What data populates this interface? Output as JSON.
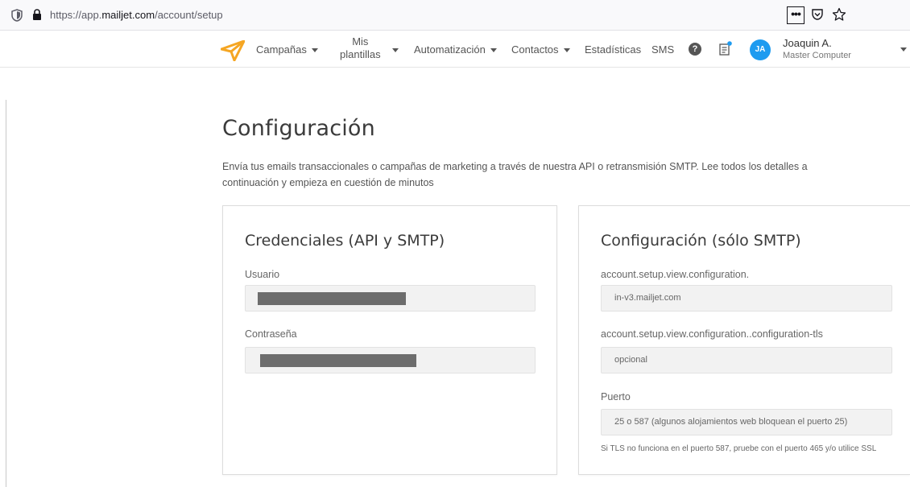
{
  "browser": {
    "url_prefix": "https://app.",
    "url_domain": "mailjet.com",
    "url_path": "/account/setup",
    "menu_glyph": "•••"
  },
  "nav": {
    "items": [
      "Campañas",
      "Mis",
      "plantillas",
      "Automatización",
      "Contactos",
      "Estadísticas",
      "SMS"
    ],
    "help_glyph": "?",
    "user_initials": "JA",
    "user_name": "Joaquin A.",
    "user_company": "Master Computer"
  },
  "colors": {
    "accent": "#1e9bf0",
    "logo_orange": "#f5a623"
  },
  "page": {
    "title": "Configuración",
    "intro": "Envía tus emails transaccionales o campañas de marketing a través de nuestra API o retransmisión SMTP. Lee todos los detalles a continuación y empieza en cuestión de minutos"
  },
  "credentials": {
    "title": "Credenciales (API y SMTP)",
    "user_label": "Usuario",
    "password_label": "Contraseña"
  },
  "smtp": {
    "title": "Configuración (sólo SMTP)",
    "host_label": "account.setup.view.configuration.",
    "host_value": "in-v3.mailjet.com",
    "tls_label": "account.setup.view.configuration..configuration-tls",
    "tls_value": "opcional",
    "port_label": "Puerto",
    "port_value": "25 o 587 (algunos alojamientos web bloquean el puerto 25)",
    "note": "Si TLS no funciona en el puerto 587, pruebe con el puerto 465 y/o utilice SSL"
  }
}
